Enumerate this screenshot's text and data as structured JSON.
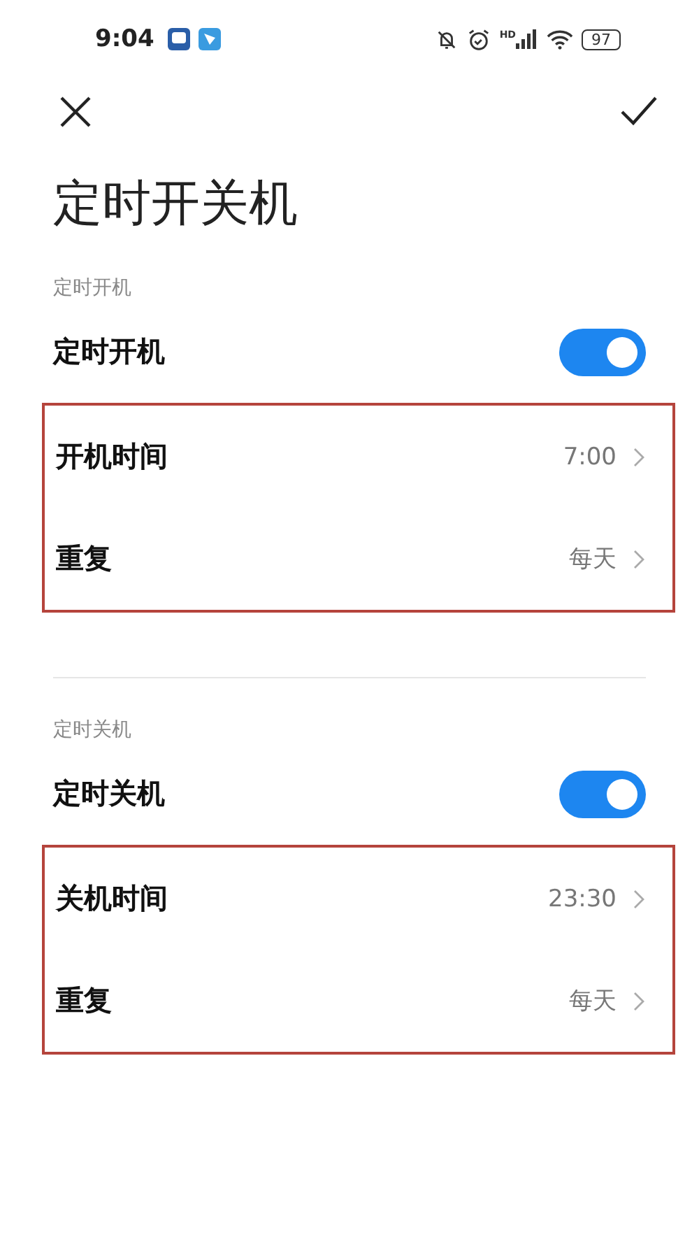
{
  "status_bar": {
    "time": "9:04",
    "network_label": "HD",
    "battery": "97"
  },
  "title": "定时开关机",
  "sections": [
    {
      "label": "定时开机",
      "toggle": {
        "label": "定时开机",
        "on": true
      },
      "highlighted": true,
      "rows": [
        {
          "label": "开机时间",
          "value": "7:00"
        },
        {
          "label": "重复",
          "value": "每天"
        }
      ]
    },
    {
      "label": "定时关机",
      "toggle": {
        "label": "定时关机",
        "on": true
      },
      "highlighted": true,
      "rows": [
        {
          "label": "关机时间",
          "value": "23:30"
        },
        {
          "label": "重复",
          "value": "每天"
        }
      ]
    }
  ]
}
